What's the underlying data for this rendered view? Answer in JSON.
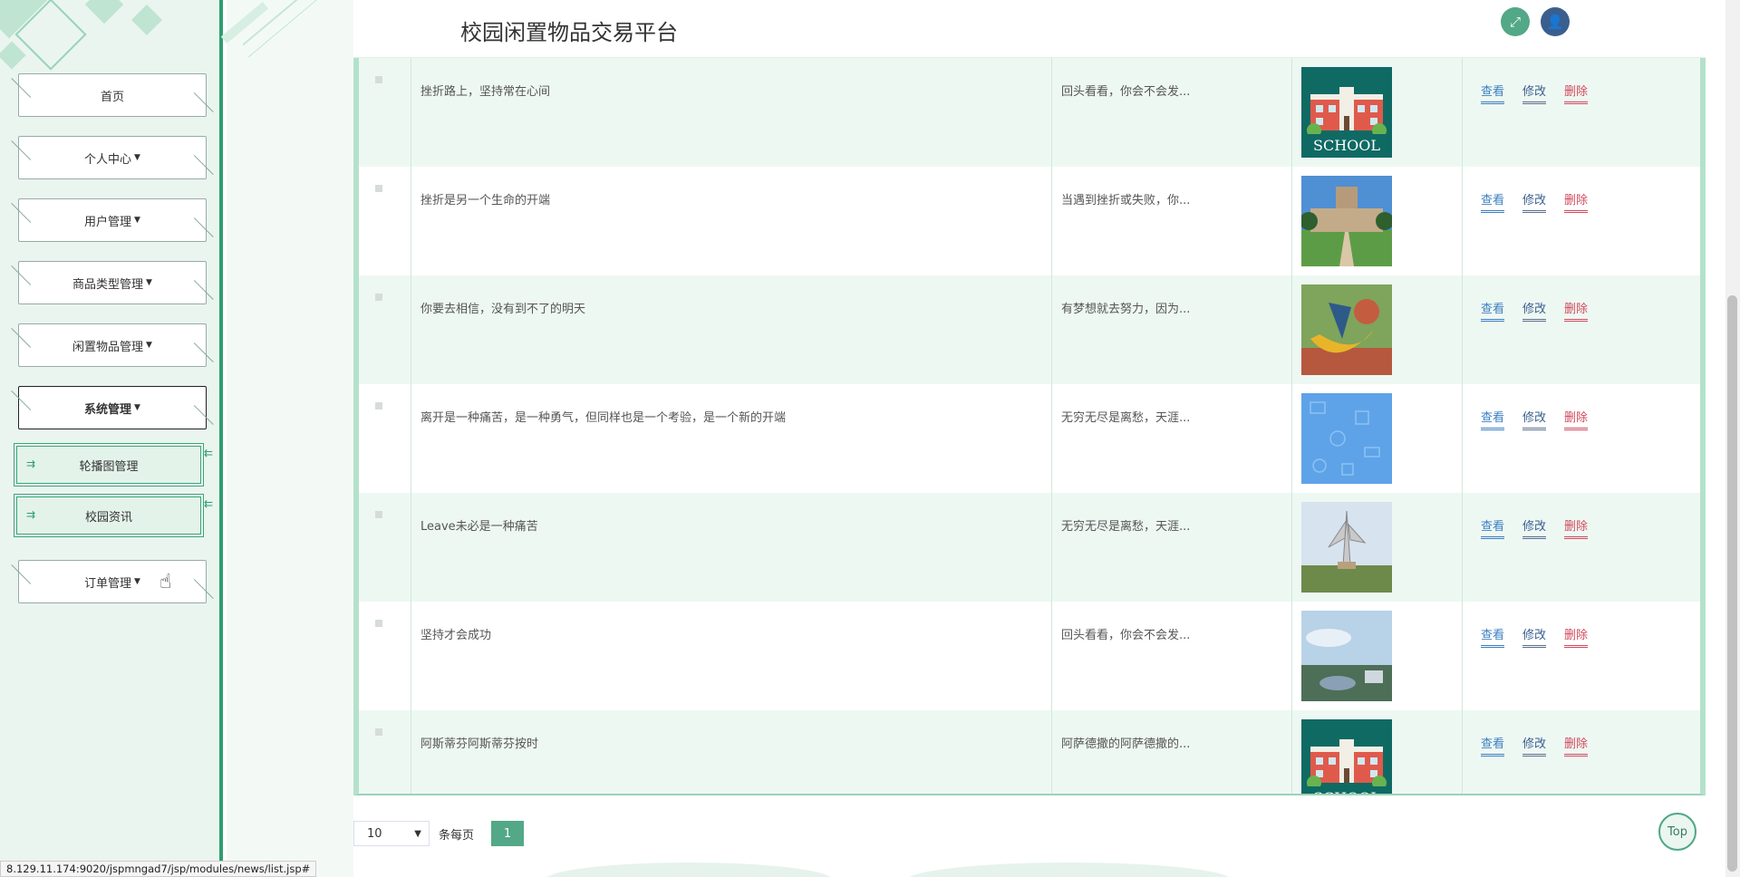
{
  "header": {
    "title": "校园闲置物品交易平台",
    "expand_icon": "expand-icon",
    "user_icon": "user-icon"
  },
  "sidebar": {
    "items": [
      {
        "label": "首页",
        "caret": false
      },
      {
        "label": "个人中心",
        "caret": true
      },
      {
        "label": "用户管理",
        "caret": true
      },
      {
        "label": "商品类型管理",
        "caret": true
      },
      {
        "label": "闲置物品管理",
        "caret": true
      },
      {
        "label": "系统管理",
        "caret": true,
        "active": true
      },
      {
        "label": "订单管理",
        "caret": true
      }
    ],
    "sub_items": [
      {
        "label": "轮播图管理"
      },
      {
        "label": "校园资讯"
      }
    ]
  },
  "table": {
    "ops": {
      "view": "查看",
      "edit": "修改",
      "delete": "删除"
    },
    "rows": [
      {
        "title": "挫折路上，坚持常在心间",
        "intro": "回头看看，你会不会发...",
        "image": "school-poster"
      },
      {
        "title": "挫折是另一个生命的开端",
        "intro": "当遇到挫折或失败，你...",
        "image": "campus-building"
      },
      {
        "title": "你要去相信，没有到不了的明天",
        "intro": "有梦想就去努力，因为...",
        "image": "sculpture"
      },
      {
        "title": "离开是一种痛苦，是一种勇气，但同样也是一个考验，是一个新的开端",
        "intro": "无穷无尽是离愁，天涯...",
        "image": "blue-pattern"
      },
      {
        "title": "Leave未必是一种痛苦",
        "intro": "无穷无尽是离愁，天涯...",
        "image": "statue"
      },
      {
        "title": "坚持才会成功",
        "intro": "回头看看，你会不会发...",
        "image": "aerial-campus"
      },
      {
        "title": "阿斯蒂芬阿斯蒂芬按时",
        "intro": "阿萨德撒的阿萨德撒的...",
        "image": "school-poster"
      }
    ]
  },
  "pagination": {
    "page_size": "10",
    "per_page_label": "条每页",
    "current_page": "1"
  },
  "top_button": "Top",
  "status_url": "8.129.11.174:9020/jspmngad7/jsp/modules/news/list.jsp#",
  "colors": {
    "accent": "#52a887",
    "sidebar_border": "#2e9e6f",
    "delete": "#d24a5c",
    "view": "#3b7fc2"
  }
}
